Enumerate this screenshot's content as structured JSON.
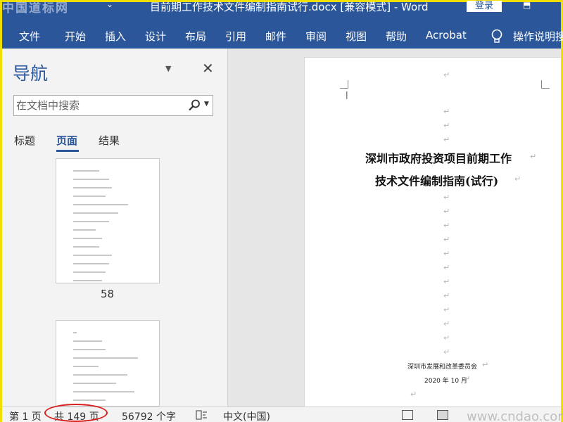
{
  "titlebar": {
    "title": "目前期工作技术文件编制指南试行.docx [兼容模式]  -  Word",
    "login_label": "登录",
    "qa_glyph": "⌄",
    "share_glyph": "⬒"
  },
  "watermarks": {
    "top_left": "中国道标网",
    "bottom_right": "www.cndao.com"
  },
  "ribbon": {
    "tabs": [
      "文件",
      "开始",
      "插入",
      "设计",
      "布局",
      "引用",
      "邮件",
      "审阅",
      "视图",
      "帮助",
      "Acrobat"
    ],
    "tellme": "操作说明搜"
  },
  "nav": {
    "title": "导航",
    "search_placeholder": "在文档中搜索",
    "tabs": [
      "标题",
      "页面",
      "结果"
    ],
    "active_tab": "页面",
    "thumb_label": "58"
  },
  "document": {
    "title_line1": "深圳市政府投资项目前期工作",
    "title_line2": "技术文件编制指南(试行)",
    "issuer": "深圳市发展和改革委员会",
    "date": "2020 年 10 月",
    "para_mark": "↵"
  },
  "status": {
    "page": "第 1 页",
    "total": "共 149 页",
    "words": "56792 个字",
    "language": "中文(中国)"
  },
  "colors": {
    "accent": "#2b579a",
    "highlight": "#d82020"
  }
}
